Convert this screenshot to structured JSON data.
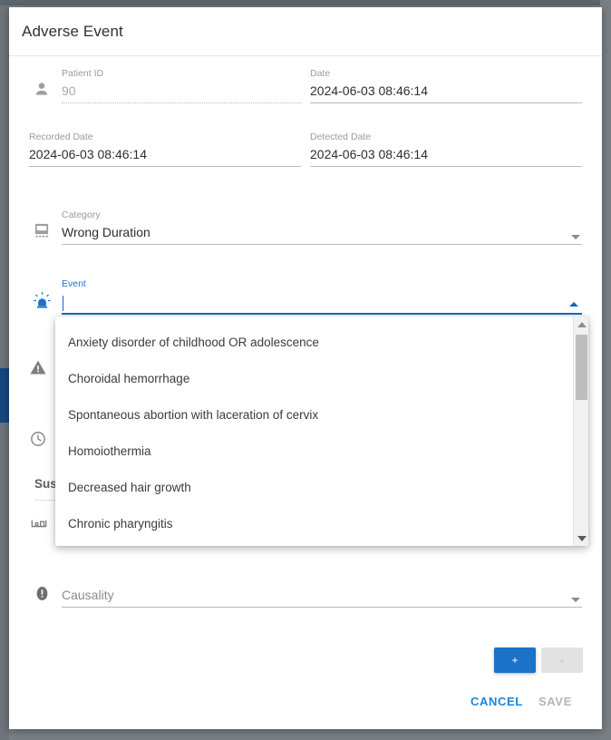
{
  "modal": {
    "title": "Adverse Event"
  },
  "fields": {
    "patient_id": {
      "label": "Patient ID",
      "value": "90",
      "icon": "person-icon"
    },
    "date": {
      "label": "Date",
      "value": "2024-06-03 08:46:14"
    },
    "recorded_date": {
      "label": "Recorded Date",
      "value": "2024-06-03 08:46:14"
    },
    "detected_date": {
      "label": "Detected Date",
      "value": "2024-06-03 08:46:14"
    },
    "category": {
      "label": "Category",
      "value": "Wrong Duration",
      "icon": "class-icon"
    },
    "event": {
      "label": "Event",
      "value": "",
      "icon": "siren-icon"
    },
    "causality": {
      "label": "",
      "placeholder": "Causality",
      "icon": "error-icon"
    }
  },
  "hidden_behind_dropdown": {
    "warning_icon": "warning-triangle-icon",
    "clock_icon": "clock-icon",
    "section_heading": "Susp",
    "device_icon": "device-icon"
  },
  "dropdown": {
    "open": true,
    "options": [
      "Anxiety disorder of childhood OR adolescence",
      "Choroidal hemorrhage",
      "Spontaneous abortion with laceration of cervix",
      "Homoiothermia",
      "Decreased hair growth",
      "Chronic pharyngitis"
    ]
  },
  "footer": {
    "add_label": "+",
    "remove_label": "-",
    "cancel_label": "CANCEL",
    "save_label": "SAVE"
  },
  "colors": {
    "accent": "#1a73c8",
    "cancel": "#1a84e2",
    "disabled": "#b5b5b5",
    "backdrop": "#7a8085",
    "nav_accent": "#16487f"
  }
}
